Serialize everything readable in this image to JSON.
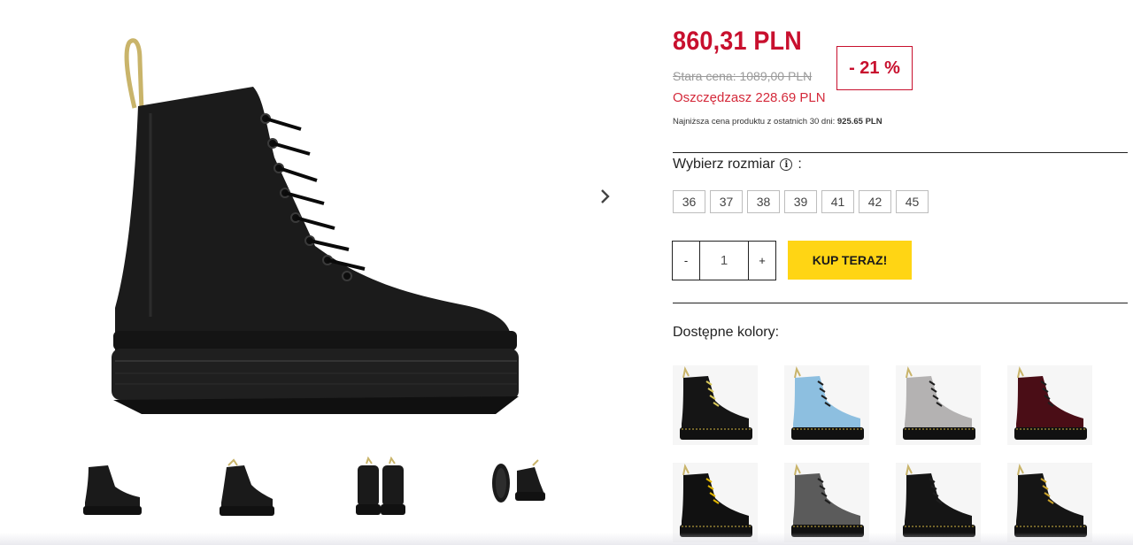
{
  "product": {
    "price": "860,31 PLN",
    "old_price": "Stara cena: 1089,00 PLN",
    "savings": "Oszczędzasz 228.69 PLN",
    "discount": "- 21 %",
    "lowest_label": "Najniższa cena produktu z ostatnich 30 dni:",
    "lowest_value": "925.65 PLN"
  },
  "sizes": {
    "title": "Wybierz rozmiar",
    "suffix": ":",
    "info_icon": "info-icon",
    "options": [
      "36",
      "37",
      "38",
      "39",
      "41",
      "42",
      "45"
    ]
  },
  "purchase": {
    "minus": "-",
    "quantity": "1",
    "plus": "+",
    "buy_label": "KUP TERAZ!"
  },
  "colors": {
    "title": "Dostępne kolory:",
    "items": [
      {
        "color": "#151515",
        "accent": "#d9c95a"
      },
      {
        "color": "#8dbfe0",
        "accent": "#1e1e1e"
      },
      {
        "color": "#b4b2b2",
        "accent": "#1e1e1e"
      },
      {
        "color": "#4a0d16",
        "accent": "#1e1e1e"
      },
      {
        "color": "#111111",
        "accent": "#e0b400"
      },
      {
        "color": "#5b5b5b",
        "accent": "#1e1e1e"
      },
      {
        "color": "#151515",
        "accent": "#1e1e1e"
      },
      {
        "color": "#151515",
        "accent": "#c9a12a"
      }
    ]
  },
  "gallery": {
    "next_icon": "chevron-right-icon",
    "thumbnails": [
      "side-view",
      "angled-view",
      "back-view",
      "sole-view"
    ]
  },
  "theme": {
    "price_color": "#c8102e",
    "buy_button_color": "#ffd514"
  }
}
